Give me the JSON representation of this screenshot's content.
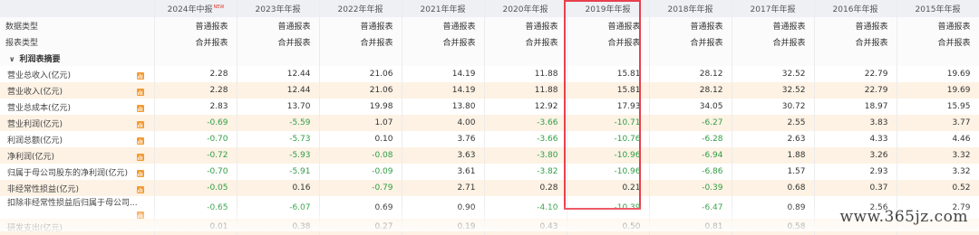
{
  "header": {
    "periods": [
      "2024年中报",
      "2023年年报",
      "2022年年报",
      "2021年年报",
      "2020年年报",
      "2019年年报",
      "2018年年报",
      "2017年年报",
      "2016年年报",
      "2015年年报"
    ],
    "new_badge": "NEW"
  },
  "meta_rows": [
    {
      "label": "数据类型",
      "values": [
        "普通报表",
        "普通报表",
        "普通报表",
        "普通报表",
        "普通报表",
        "普通报表",
        "普通报表",
        "普通报表",
        "普通报表",
        "普通报表"
      ]
    },
    {
      "label": "报表类型",
      "values": [
        "合并报表",
        "合并报表",
        "合并报表",
        "合并报表",
        "合并报表",
        "合并报表",
        "合并报表",
        "合并报表",
        "合并报表",
        "合并报表"
      ]
    }
  ],
  "section": {
    "label": "利润表摘要"
  },
  "rows": [
    {
      "label": "营业总收入(亿元)",
      "values": [
        "2.28",
        "12.44",
        "21.06",
        "14.19",
        "11.88",
        "15.81",
        "28.12",
        "32.52",
        "22.79",
        "19.69"
      ]
    },
    {
      "label": "营业收入(亿元)",
      "values": [
        "2.28",
        "12.44",
        "21.06",
        "14.19",
        "11.88",
        "15.81",
        "28.12",
        "32.52",
        "22.79",
        "19.69"
      ]
    },
    {
      "label": "营业总成本(亿元)",
      "values": [
        "2.83",
        "13.70",
        "19.98",
        "13.80",
        "12.92",
        "17.93",
        "34.05",
        "30.72",
        "18.97",
        "15.95"
      ]
    },
    {
      "label": "营业利润(亿元)",
      "values": [
        "-0.69",
        "-5.59",
        "1.07",
        "4.00",
        "-3.66",
        "-10.71",
        "-6.27",
        "2.55",
        "3.83",
        "3.77"
      ]
    },
    {
      "label": "利润总额(亿元)",
      "values": [
        "-0.70",
        "-5.73",
        "0.10",
        "3.76",
        "-3.66",
        "-10.76",
        "-6.28",
        "2.63",
        "4.33",
        "4.46"
      ]
    },
    {
      "label": "净利润(亿元)",
      "values": [
        "-0.72",
        "-5.93",
        "-0.08",
        "3.63",
        "-3.80",
        "-10.96",
        "-6.94",
        "1.88",
        "3.26",
        "3.32"
      ]
    },
    {
      "label": "归属于母公司股东的净利润(亿元)",
      "values": [
        "-0.70",
        "-5.91",
        "-0.09",
        "3.61",
        "-3.82",
        "-10.96",
        "-6.86",
        "1.57",
        "2.93",
        "3.32"
      ]
    },
    {
      "label": "非经常性损益(亿元)",
      "values": [
        "-0.05",
        "0.16",
        "-0.79",
        "2.71",
        "0.28",
        "0.21",
        "-0.39",
        "0.68",
        "0.37",
        "0.52"
      ]
    },
    {
      "label": "扣除非经常性损益后归属于母公司...",
      "values": [
        "-0.65",
        "-6.07",
        "0.69",
        "0.90",
        "-4.10",
        "-10.39",
        "-6.47",
        "0.89",
        "2.56",
        "2.79"
      ]
    },
    {
      "label": "研发支出(亿元)",
      "values": [
        "0.01",
        "0.38",
        "0.27",
        "0.19",
        "0.43",
        "0.50",
        "0.81",
        "0.58",
        "",
        ""
      ]
    }
  ],
  "highlighted_period": "2019年年报",
  "watermark": "www.365jz.com",
  "colors": {
    "negative": "#2f9e44",
    "highlight_border": "#e8404e",
    "header_bg": "#eef0f4",
    "row_alt_bg": "#fdf2e4",
    "chart_icon": "#f39c34"
  }
}
